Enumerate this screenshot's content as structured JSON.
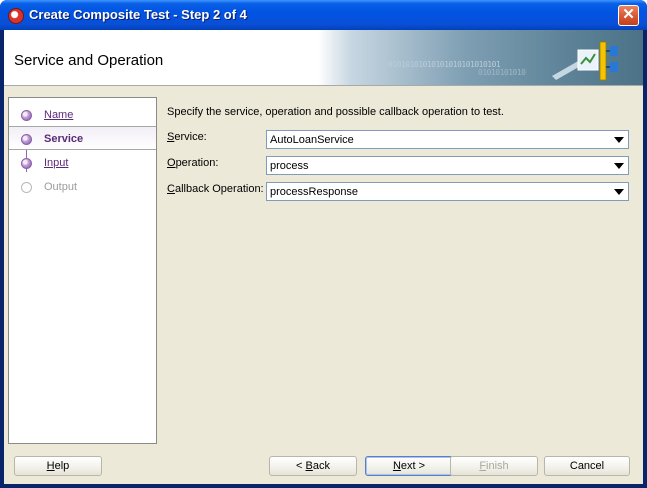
{
  "window": {
    "title": "Create Composite Test - Step 2 of 4",
    "close_glyph": "✕"
  },
  "banner": {
    "heading": "Service and Operation",
    "binary_line_1": "01010101010101010101010101",
    "binary_line_2": "01010101010"
  },
  "nav": {
    "items": [
      {
        "label": "Name",
        "state": "link"
      },
      {
        "label": "Service",
        "state": "current"
      },
      {
        "label": "Input",
        "state": "link"
      },
      {
        "label": "Output",
        "state": "disabled"
      }
    ]
  },
  "form": {
    "instructions": "Specify the service, operation and possible callback operation to test.",
    "fields": [
      {
        "mnemonic": "S",
        "rest": "ervice:",
        "value": "AutoLoanService"
      },
      {
        "mnemonic": "O",
        "rest": "peration:",
        "value": "process"
      },
      {
        "mnemonic": "C",
        "rest": "allback Operation:",
        "value": "processResponse"
      }
    ]
  },
  "buttons": {
    "help": {
      "mnemonic": "H",
      "rest": "elp"
    },
    "back": {
      "prefix": "< ",
      "mnemonic": "B",
      "rest": "ack"
    },
    "next": {
      "mnemonic": "N",
      "rest": "ext >"
    },
    "finish": {
      "mnemonic": "F",
      "rest": "inish"
    },
    "cancel": {
      "label": "Cancel"
    }
  },
  "colors": {
    "titlebar": "#0054e3",
    "dialog_bg": "#ece9d8",
    "nav_accent": "#5a2a7a"
  }
}
